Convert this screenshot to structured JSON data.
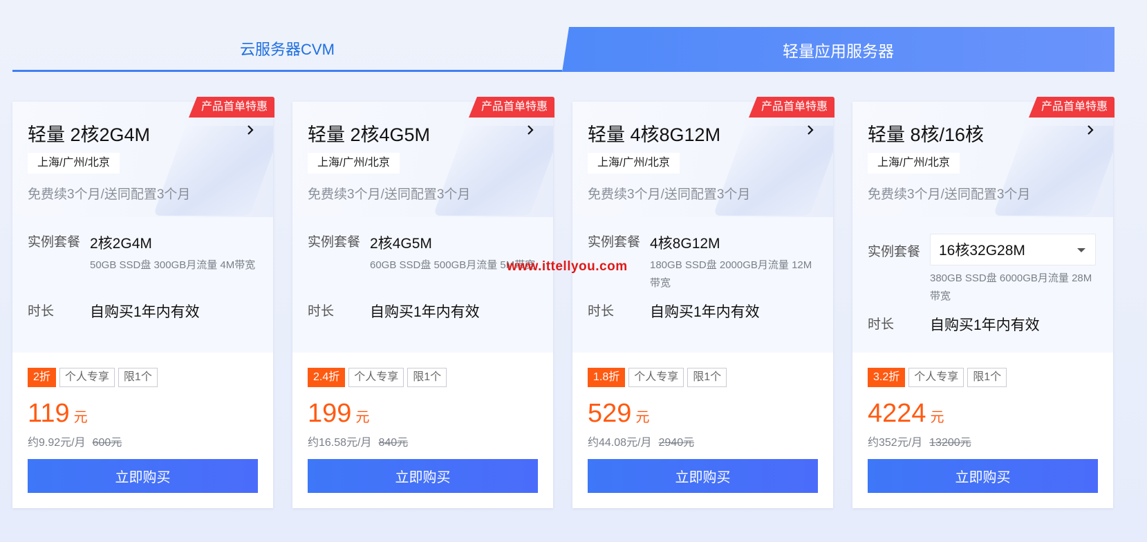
{
  "tabs": [
    {
      "label": "云服务器CVM",
      "active": false
    },
    {
      "label": "轻量应用服务器",
      "active": true
    }
  ],
  "watermark": "www.ittellyou.com",
  "labels": {
    "instance": "实例套餐",
    "duration": "时长",
    "currency_unit": "元"
  },
  "cards": [
    {
      "promo": "产品首单特惠",
      "title": "轻量 2核2G4M",
      "region": "上海/广州/北京",
      "note": "免费续3个月/送同配置3个月",
      "instance_value": "2核2G4M",
      "instance_spec": "50GB SSD盘 300GB月流量 4M带宽",
      "duration_value": "自购买1年内有效",
      "discount": "2折",
      "tag_personal": "个人专享",
      "tag_limit": "限1个",
      "price": "119",
      "monthly": "约9.92元/月",
      "original": "600元",
      "buy": "立即购买"
    },
    {
      "promo": "产品首单特惠",
      "title": "轻量 2核4G5M",
      "region": "上海/广州/北京",
      "note": "免费续3个月/送同配置3个月",
      "instance_value": "2核4G5M",
      "instance_spec": "60GB SSD盘 500GB月流量 5M带宽",
      "duration_value": "自购买1年内有效",
      "discount": "2.4折",
      "tag_personal": "个人专享",
      "tag_limit": "限1个",
      "price": "199",
      "monthly": "约16.58元/月",
      "original": "840元",
      "buy": "立即购买"
    },
    {
      "promo": "产品首单特惠",
      "title": "轻量 4核8G12M",
      "region": "上海/广州/北京",
      "note": "免费续3个月/送同配置3个月",
      "instance_value": "4核8G12M",
      "instance_spec": "180GB SSD盘 2000GB月流量 12M带宽",
      "duration_value": "自购买1年内有效",
      "discount": "1.8折",
      "tag_personal": "个人专享",
      "tag_limit": "限1个",
      "price": "529",
      "monthly": "约44.08元/月",
      "original": "2940元",
      "buy": "立即购买"
    },
    {
      "promo": "产品首单特惠",
      "title": "轻量 8核/16核",
      "region": "上海/广州/北京",
      "note": "免费续3个月/送同配置3个月",
      "instance_value": "16核32G28M",
      "instance_spec": "380GB SSD盘 6000GB月流量 28M带宽",
      "duration_value": "自购买1年内有效",
      "discount": "3.2折",
      "tag_personal": "个人专享",
      "tag_limit": "限1个",
      "price": "4224",
      "monthly": "约352元/月",
      "original": "13200元",
      "buy": "立即购买"
    }
  ],
  "icons": {
    "chevron": "chevron-right-icon",
    "dropdown": "caret-down-icon"
  },
  "colors": {
    "accent": "#3e77f7",
    "price": "#ff5a12",
    "promo": "#f03a3e"
  }
}
